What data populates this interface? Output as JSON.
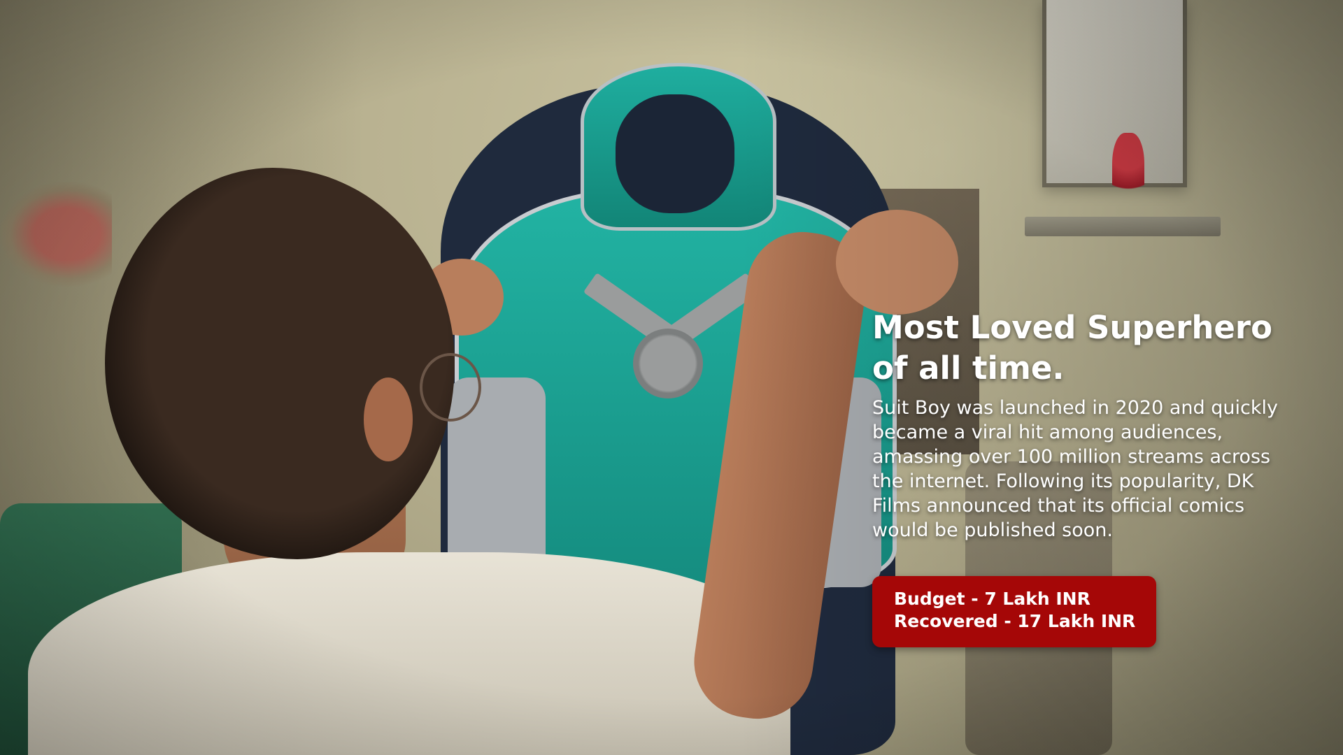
{
  "slide": {
    "headline": "Most Loved Superhero of all time.",
    "description": "Suit Boy was launched in 2020 and quickly became a viral hit among audiences, amassing over 100 million streams across the internet. Following its popularity, DK Films announced that its official comics would be published soon.",
    "badge": {
      "budget": "Budget - 7 Lakh INR",
      "recovered": "Recovered - 17 Lakh INR"
    }
  },
  "colors": {
    "badge_background": "#a50707",
    "text": "#ffffff",
    "suit_teal": "#1fae9f",
    "suit_navy": "#1f2a3d"
  }
}
